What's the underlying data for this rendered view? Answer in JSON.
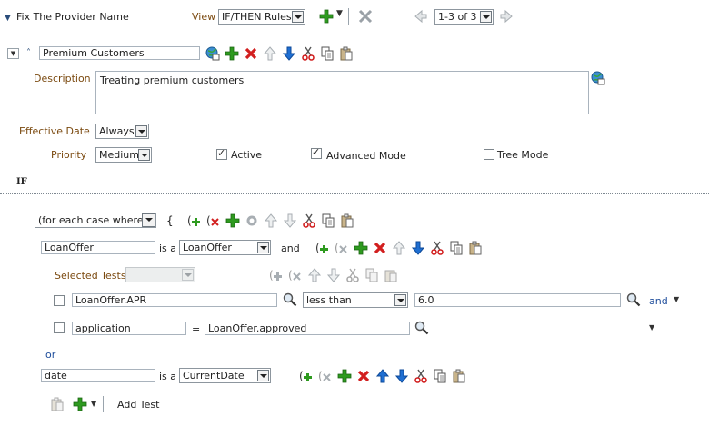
{
  "header": {
    "rule_set_title": "Fix The Provider Name",
    "view_label": "View",
    "view_value": "IF/THEN Rules",
    "pager_value": "1-3 of 3"
  },
  "rule": {
    "name": "Premium Customers",
    "description_label": "Description",
    "description": "Treating premium customers",
    "effective_date_label": "Effective Date",
    "effective_date_value": "Always",
    "priority_label": "Priority",
    "priority_value": "Medium",
    "active_label": "Active",
    "advanced_mode_label": "Advanced Mode",
    "tree_mode_label": "Tree Mode",
    "active_checked": true,
    "advanced_mode_checked": true,
    "tree_mode_checked": false
  },
  "if_section": {
    "title": "IF",
    "case_select": "(for each case where)",
    "open_brace": "{",
    "pattern1": {
      "var": "LoanOffer",
      "is_a": "is a",
      "type": "LoanOffer",
      "conj": "and"
    },
    "selected_tests_label": "Selected Tests",
    "test1": {
      "left": "LoanOffer.APR",
      "op": "less than",
      "right": "6.0",
      "conj": "and"
    },
    "test2": {
      "left": "application",
      "op": "=",
      "right": "LoanOffer.approved"
    },
    "or_label": "or",
    "pattern2": {
      "var": "date",
      "is_a": "is a",
      "type": "CurrentDate"
    },
    "add_test_label": "Add Test"
  },
  "colors": {
    "label_brown": "#7b4a10",
    "add_green": "#2e9a1f",
    "delete_red": "#d21f1f",
    "move_blue": "#1f6fd2",
    "separator": "#b9c3cc"
  }
}
